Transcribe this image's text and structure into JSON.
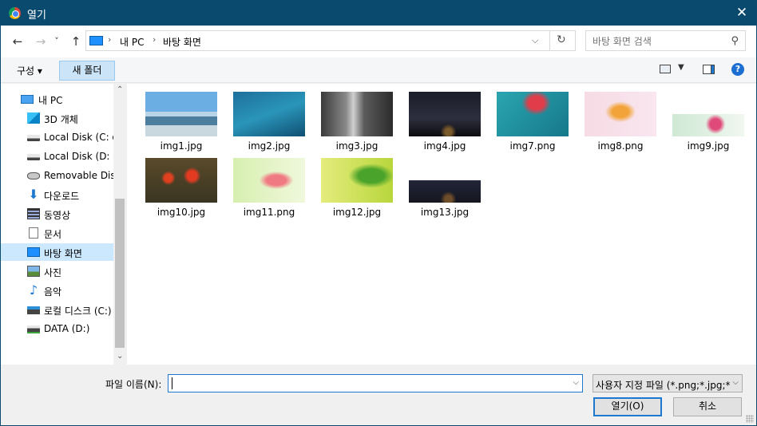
{
  "window": {
    "title": "열기",
    "close_glyph": "✕"
  },
  "nav": {
    "back_glyph": "←",
    "forward_glyph": "→",
    "recent_glyph": "˅",
    "up_glyph": "↑",
    "breadcrumbs": [
      "내 PC",
      "바탕 화면"
    ],
    "crumb_sep": "›",
    "address_dropdown_glyph": "⌵",
    "refresh_glyph": "↻",
    "search_placeholder": "바탕 화면 검색",
    "search_glyph": "⚲"
  },
  "toolbar": {
    "organize_label": "구성 ▾",
    "new_folder_label": "새 폴더",
    "view_dropdown_glyph": "▼",
    "help_glyph": "?"
  },
  "tree": {
    "items": [
      {
        "label": "내 PC",
        "icon": "computer-icon"
      },
      {
        "label": "3D 개체",
        "icon": "3d-objects-icon"
      },
      {
        "label": "Local Disk (C: on",
        "icon": "disk-icon"
      },
      {
        "label": "Local Disk (D: on",
        "icon": "disk-icon"
      },
      {
        "label": "Removable Disk",
        "icon": "removable-disk-icon"
      },
      {
        "label": "다운로드",
        "icon": "download-icon"
      },
      {
        "label": "동영상",
        "icon": "video-icon"
      },
      {
        "label": "문서",
        "icon": "document-icon"
      },
      {
        "label": "바탕 화면",
        "icon": "desktop-icon",
        "selected": true
      },
      {
        "label": "사진",
        "icon": "pictures-icon"
      },
      {
        "label": "음악",
        "icon": "music-icon"
      },
      {
        "label": "로컬 디스크 (C:)",
        "icon": "local-disk-icon"
      },
      {
        "label": "DATA (D:)",
        "icon": "data-disk-icon"
      }
    ],
    "scroll_up_glyph": "⌃",
    "scroll_down_glyph": "⌄"
  },
  "files": [
    {
      "name": "img1.jpg"
    },
    {
      "name": "img2.jpg"
    },
    {
      "name": "img3.jpg"
    },
    {
      "name": "img4.jpg"
    },
    {
      "name": "img7.png"
    },
    {
      "name": "img8.png"
    },
    {
      "name": "img9.jpg"
    },
    {
      "name": "img10.jpg"
    },
    {
      "name": "img11.png"
    },
    {
      "name": "img12.jpg"
    },
    {
      "name": "img13.jpg"
    }
  ],
  "bottom": {
    "file_name_label": "파일 이름(N):",
    "file_name_value": "",
    "filter_label": "사용자 지정 파일 (*.png;*.jpg;*",
    "dropdown_glyph": "⌵",
    "open_label": "열기(O)",
    "cancel_label": "취소"
  },
  "colors": {
    "titlebar": "#0b4a6f",
    "selection": "#cce8ff",
    "accent": "#1e78d0"
  }
}
